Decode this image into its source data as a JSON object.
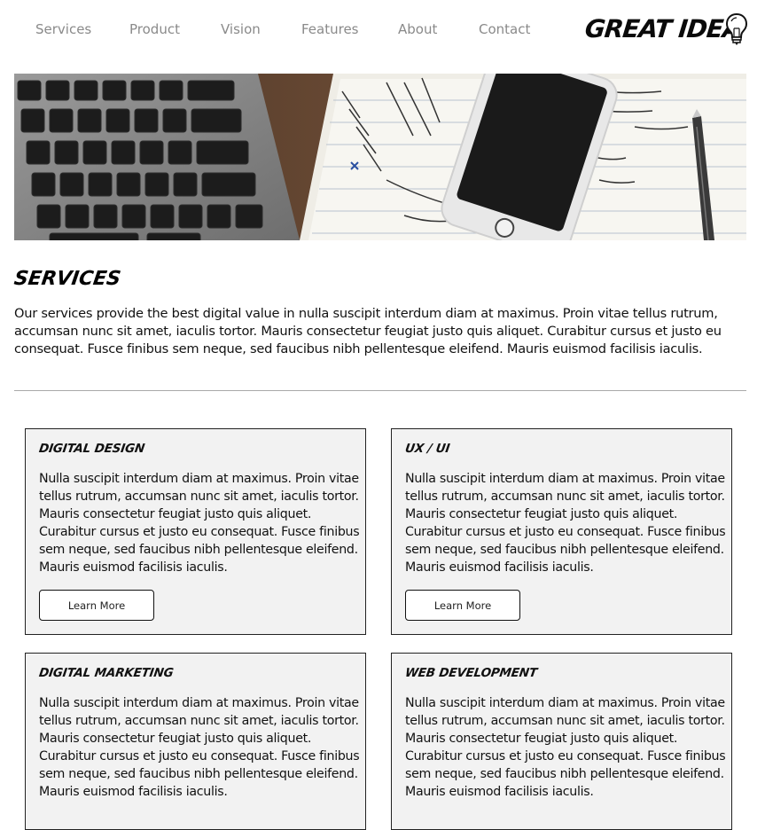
{
  "nav": {
    "links": [
      "Services",
      "Product",
      "Vision",
      "Features",
      "About",
      "Contact"
    ],
    "logo_text": "GREAT IDEA"
  },
  "services": {
    "title": "Services",
    "intro": "Our services provide the best digital value in nulla suscipit interdum diam at maximus. Proin vitae tellus rutrum, accumsan nunc sit amet, iaculis tortor. Mauris consectetur feugiat justo quis aliquet. Curabitur cursus et justo eu consequat. Fusce finibus sem neque, sed faucibus nibh pellentesque eleifend. Mauris euismod facilisis iaculis."
  },
  "cards": [
    {
      "title": "Digital Design",
      "text": "Nulla suscipit interdum diam at maximus. Proin vitae tellus rutrum, accumsan nunc sit amet, iaculis tortor. Mauris consectetur feugiat justo quis aliquet. Curabitur cursus et justo eu consequat. Fusce finibus sem neque, sed faucibus nibh pellentesque eleifend. Mauris euismod facilisis iaculis.",
      "button": "Learn More"
    },
    {
      "title": "UX / UI",
      "text": "Nulla suscipit interdum diam at maximus. Proin vitae tellus rutrum, accumsan nunc sit amet, iaculis tortor. Mauris consectetur feugiat justo quis aliquet. Curabitur cursus et justo eu consequat. Fusce finibus sem neque, sed faucibus nibh pellentesque eleifend. Mauris euismod facilisis iaculis.",
      "button": "Learn More"
    },
    {
      "title": "Digital Marketing",
      "text": "Nulla suscipit interdum diam at maximus. Proin vitae tellus rutrum, accumsan nunc sit amet, iaculis tortor. Mauris consectetur feugiat justo quis aliquet. Curabitur cursus et justo eu consequat. Fusce finibus sem neque, sed faucibus nibh pellentesque eleifend. Mauris euismod facilisis iaculis."
    },
    {
      "title": "Web Development",
      "text": "Nulla suscipit interdum diam at maximus. Proin vitae tellus rutrum, accumsan nunc sit amet, iaculis tortor. Mauris consectetur feugiat justo quis aliquet. Curabitur cursus et justo eu consequat. Fusce finibus sem neque, sed faucibus nibh pellentesque eleifend. Mauris euismod facilisis iaculis."
    }
  ],
  "icons": {
    "logo_icon": "lightbulb-icon"
  },
  "colors": {
    "nav_link": "#8a8a8a",
    "card_background": "#f2f2f2",
    "divider": "#a9a9a9"
  }
}
